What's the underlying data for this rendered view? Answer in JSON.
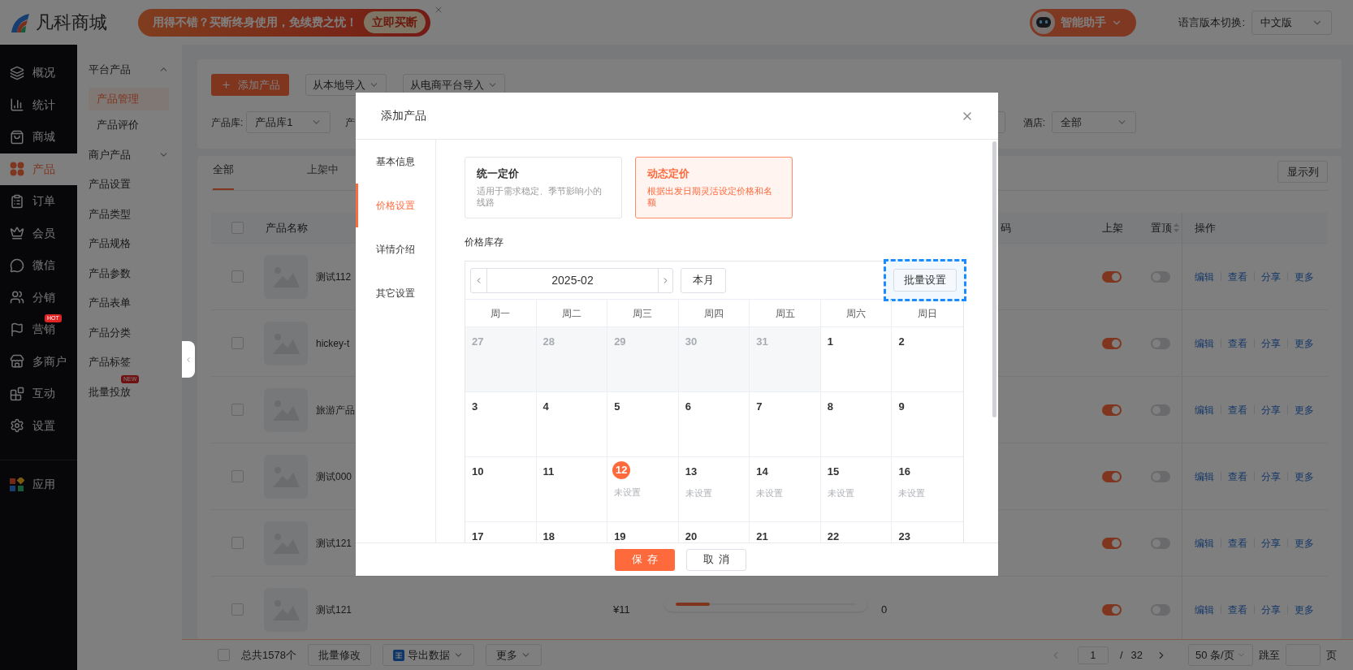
{
  "header": {
    "logo_text": "凡科商城",
    "promo": {
      "text": "用得不错？买断终身使用，免续费之忧！",
      "button": "立即买断"
    },
    "assistant": {
      "label": "智能助手"
    },
    "language": {
      "label": "语言版本切换:",
      "value": "中文版"
    }
  },
  "sidebar": {
    "items": [
      {
        "label": "概况",
        "selected": false
      },
      {
        "label": "统计",
        "selected": false
      },
      {
        "label": "商城",
        "selected": false
      },
      {
        "label": "产品",
        "selected": true
      },
      {
        "label": "订单",
        "selected": false
      },
      {
        "label": "会员",
        "selected": false
      },
      {
        "label": "微信",
        "selected": false
      },
      {
        "label": "分销",
        "selected": false
      },
      {
        "label": "营销",
        "selected": false,
        "badge": "HOT"
      },
      {
        "label": "多商户",
        "selected": false
      },
      {
        "label": "互动",
        "selected": false
      },
      {
        "label": "设置",
        "selected": false
      }
    ],
    "apps": {
      "label": "应用"
    }
  },
  "subnav": {
    "groups": [
      {
        "label": "平台产品",
        "expanded": true,
        "children": [
          {
            "label": "产品管理",
            "selected": true
          },
          {
            "label": "产品评价",
            "selected": false
          }
        ]
      },
      {
        "label": "商户产品",
        "expanded": false
      }
    ],
    "items": [
      {
        "label": "产品设置"
      },
      {
        "label": "产品类型"
      },
      {
        "label": "产品规格"
      },
      {
        "label": "产品参数"
      },
      {
        "label": "产品表单"
      },
      {
        "label": "产品分类"
      },
      {
        "label": "产品标签"
      },
      {
        "label": "批量投放",
        "badge": "NEW"
      }
    ]
  },
  "toolbar": {
    "add_button": "添加产品",
    "imports": [
      "从本地导入",
      "从电商平台导入"
    ],
    "filters_left": [
      {
        "label": "产品库:",
        "value": "产品库1"
      },
      {
        "label": "产"
      }
    ],
    "filters_right": [
      {
        "label": "酒店:",
        "value": "全部"
      }
    ]
  },
  "table": {
    "tabs": [
      {
        "label": "全部",
        "selected": true
      },
      {
        "label": "上架中",
        "selected": false
      }
    ],
    "column_button": "显示列",
    "all_checked": false,
    "columns": [
      {
        "label": "产品名称",
        "sortable": false
      },
      {
        "label": "码",
        "sortable": false
      },
      {
        "label": "上架",
        "sortable": false
      },
      {
        "label": "置顶",
        "sortable": true
      },
      {
        "label": "操作",
        "sortable": false
      }
    ],
    "rows": [
      {
        "name": "测试112",
        "checked": false,
        "listed": true,
        "pinned": false,
        "actions": [
          "编辑",
          "查看",
          "分享",
          "更多"
        ]
      },
      {
        "name": "hickey-t",
        "checked": false,
        "listed": true,
        "pinned": false,
        "actions": [
          "编辑",
          "查看",
          "分享",
          "更多"
        ]
      },
      {
        "name": "旅游产品",
        "checked": false,
        "listed": true,
        "pinned": false,
        "actions": [
          "编辑",
          "查看",
          "分享",
          "更多"
        ]
      },
      {
        "name": "测试000",
        "checked": false,
        "listed": true,
        "pinned": false,
        "actions": [
          "编辑",
          "查看",
          "分享",
          "更多"
        ]
      },
      {
        "name": "测试121",
        "checked": false,
        "listed": true,
        "pinned": false,
        "actions": [
          "编辑",
          "查看",
          "分享",
          "更多"
        ]
      },
      {
        "name": "测试121",
        "checked": false,
        "price": "¥11",
        "stock": "0",
        "listed": true,
        "pinned": false,
        "actions": [
          "编辑",
          "查看",
          "分享",
          "更多"
        ]
      }
    ]
  },
  "footer": {
    "all_checked": false,
    "total": "总共1578个",
    "buttons": [
      {
        "label": "批量修改",
        "kind": "plain"
      },
      {
        "label": "导出数据",
        "kind": "export"
      },
      {
        "label": "更多",
        "kind": "menu"
      }
    ],
    "pagination": {
      "page": "1",
      "separator": "/",
      "pages": "32",
      "page_size": "50 条/页",
      "jump_label": "跳至",
      "page_unit": "页"
    }
  },
  "modal": {
    "title": "添加产品",
    "tabs": [
      {
        "label": "基本信息",
        "selected": false
      },
      {
        "label": "价格设置",
        "selected": true
      },
      {
        "label": "详情介绍",
        "selected": false
      },
      {
        "label": "其它设置",
        "selected": false
      }
    ],
    "pricing_modes": [
      {
        "title": "统一定价",
        "description": "适用于需求稳定、季节影响小的线路",
        "selected": false
      },
      {
        "title": "动态定价",
        "description": "根据出发日期灵活设定价格和名额",
        "selected": true
      }
    ],
    "section_label": "价格库存",
    "calendar": {
      "month": "2025-02",
      "today_button": "本月",
      "batch_button": "批量设置",
      "batch_focused": true,
      "weekdays": [
        "周一",
        "周二",
        "周三",
        "周四",
        "周五",
        "周六",
        "周日"
      ],
      "weeks": [
        [
          {
            "day": "27",
            "in_month": false,
            "today": false
          },
          {
            "day": "28",
            "in_month": false,
            "today": false
          },
          {
            "day": "29",
            "in_month": false,
            "today": false
          },
          {
            "day": "30",
            "in_month": false,
            "today": false
          },
          {
            "day": "31",
            "in_month": false,
            "today": false
          },
          {
            "day": "1",
            "in_month": true,
            "today": false
          },
          {
            "day": "2",
            "in_month": true,
            "today": false
          }
        ],
        [
          {
            "day": "3",
            "in_month": true,
            "today": false
          },
          {
            "day": "4",
            "in_month": true,
            "today": false
          },
          {
            "day": "5",
            "in_month": true,
            "today": false
          },
          {
            "day": "6",
            "in_month": true,
            "today": false
          },
          {
            "day": "7",
            "in_month": true,
            "today": false
          },
          {
            "day": "8",
            "in_month": true,
            "today": false
          },
          {
            "day": "9",
            "in_month": true,
            "today": false
          }
        ],
        [
          {
            "day": "10",
            "in_month": true,
            "today": false
          },
          {
            "day": "11",
            "in_month": true,
            "today": false
          },
          {
            "day": "12",
            "in_month": true,
            "today": true,
            "note": "未设置"
          },
          {
            "day": "13",
            "in_month": true,
            "today": false,
            "note": "未设置"
          },
          {
            "day": "14",
            "in_month": true,
            "today": false,
            "note": "未设置"
          },
          {
            "day": "15",
            "in_month": true,
            "today": false,
            "note": "未设置"
          },
          {
            "day": "16",
            "in_month": true,
            "today": false,
            "note": "未设置"
          }
        ],
        [
          {
            "day": "17",
            "in_month": true,
            "today": false
          },
          {
            "day": "18",
            "in_month": true,
            "today": false
          },
          {
            "day": "19",
            "in_month": true,
            "today": false
          },
          {
            "day": "20",
            "in_month": true,
            "today": false
          },
          {
            "day": "21",
            "in_month": true,
            "today": false
          },
          {
            "day": "22",
            "in_month": true,
            "today": false
          },
          {
            "day": "23",
            "in_month": true,
            "today": false
          }
        ]
      ]
    },
    "buttons": {
      "save": "保存",
      "cancel": "取消"
    }
  }
}
